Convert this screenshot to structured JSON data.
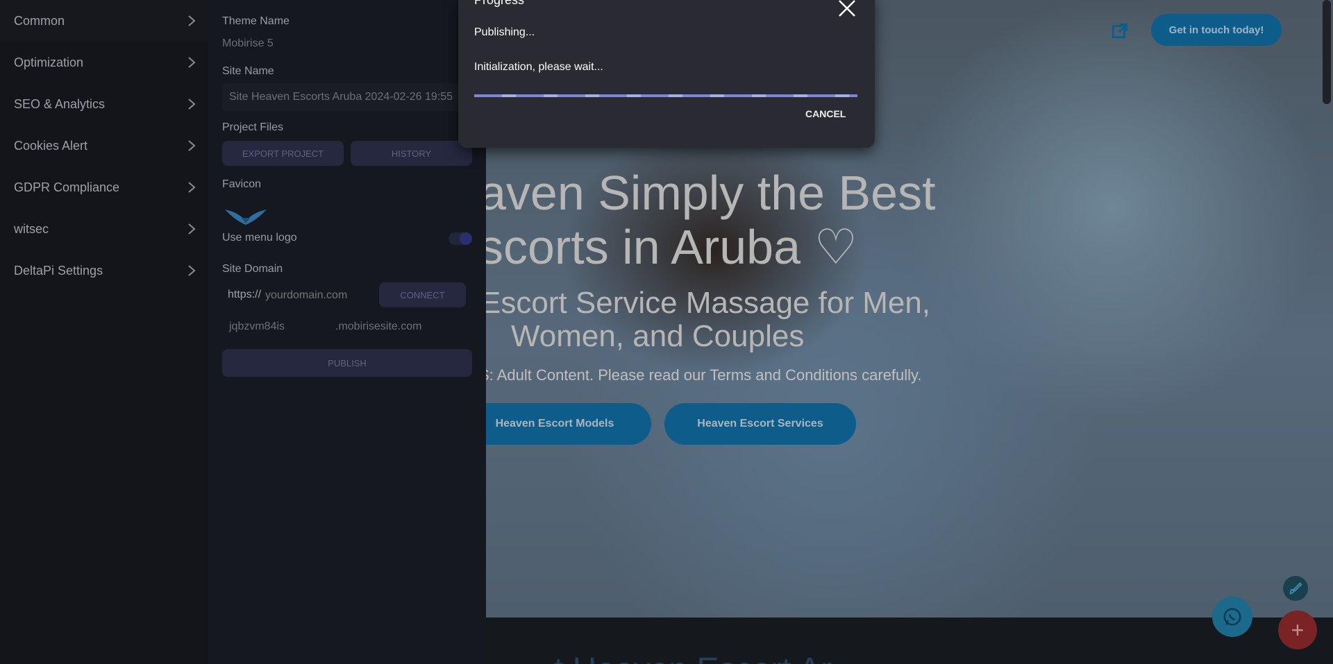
{
  "sidebar": {
    "items": [
      {
        "label": "Common"
      },
      {
        "label": "Optimization"
      },
      {
        "label": "SEO & Analytics"
      },
      {
        "label": "Cookies Alert"
      },
      {
        "label": "GDPR Compliance"
      },
      {
        "label": "witsec"
      },
      {
        "label": "DeltaPi Settings"
      }
    ]
  },
  "settings": {
    "theme_name_label": "Theme Name",
    "theme_name_value": "Mobirise 5",
    "site_name_label": "Site Name",
    "site_name_value": "Site Heaven Escorts Aruba 2024-02-26 19:55",
    "project_files_label": "Project Files",
    "export_button": "EXPORT PROJECT",
    "history_button": "HISTORY",
    "favicon_label": "Favicon",
    "use_menu_logo_label": "Use menu logo",
    "use_menu_logo_on": true,
    "site_domain_label": "Site Domain",
    "domain_prefix": "https://",
    "domain_placeholder": "yourdomain.com",
    "connect_button": "CONNECT",
    "subdomain_value": "jqbzvm84is",
    "subdomain_suffix": ".mobirisesite.com",
    "publish_button": "PUBLISH"
  },
  "dialog": {
    "title": "Progress",
    "status": "Publishing...",
    "detail": "Initialization, please wait...",
    "cancel_label": "CANCEL"
  },
  "preview": {
    "cta_label": "Get in touch today!",
    "heading_line1": "aven Simply the Best",
    "heading_line2": "scorts in Aruba ♡",
    "subheading_line1": "Escort Service Massage for Men,",
    "subheading_line2": "Women, and Couples",
    "notice": "S: Adult Content. Please read our Terms and Conditions carefully.",
    "button_models": "Heaven Escort Models",
    "button_services": "Heaven Escort Services",
    "bottom_heading": "t Heaven Escort Ar"
  }
}
